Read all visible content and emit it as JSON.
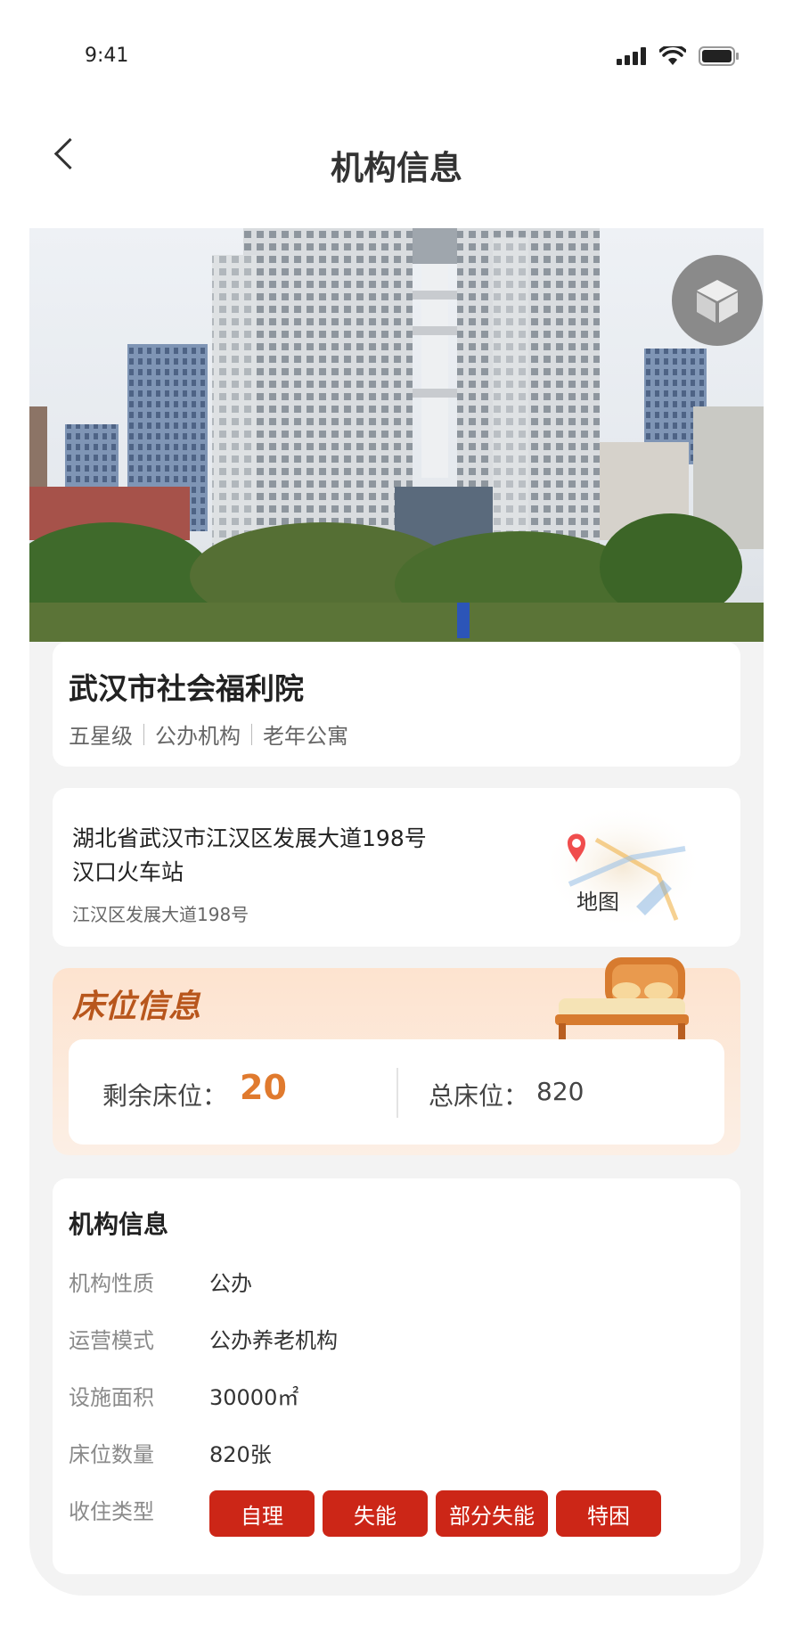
{
  "status_bar": {
    "time": "9:41"
  },
  "nav": {
    "title": "机构信息"
  },
  "institution": {
    "name": "武汉市社会福利院",
    "tags": [
      "五星级",
      "公办机构",
      "老年公寓"
    ]
  },
  "address": {
    "line1": "湖北省武汉市江汉区发展大道198号",
    "line2": "汉口火车站",
    "detail": "江汉区发展大道198号",
    "map_label": "地图"
  },
  "beds": {
    "title": "床位信息",
    "remaining_label": "剩余床位：",
    "remaining_value": "20",
    "total_label": "总床位：",
    "total_value": "820"
  },
  "info": {
    "title": "机构信息",
    "rows": [
      {
        "label": "机构性质",
        "value": "公办"
      },
      {
        "label": "运营模式",
        "value": "公办养老机构"
      },
      {
        "label": "设施面积",
        "value": "30000㎡"
      },
      {
        "label": "床位数量",
        "value": "820张"
      },
      {
        "label": "收住类型",
        "value": ""
      }
    ],
    "care_types": [
      "自理",
      "失能",
      "部分失能",
      "特困"
    ]
  },
  "colors": {
    "accent_red": "#cc2617",
    "bed_orange": "#e07a2e",
    "bed_title": "#b8561c"
  }
}
